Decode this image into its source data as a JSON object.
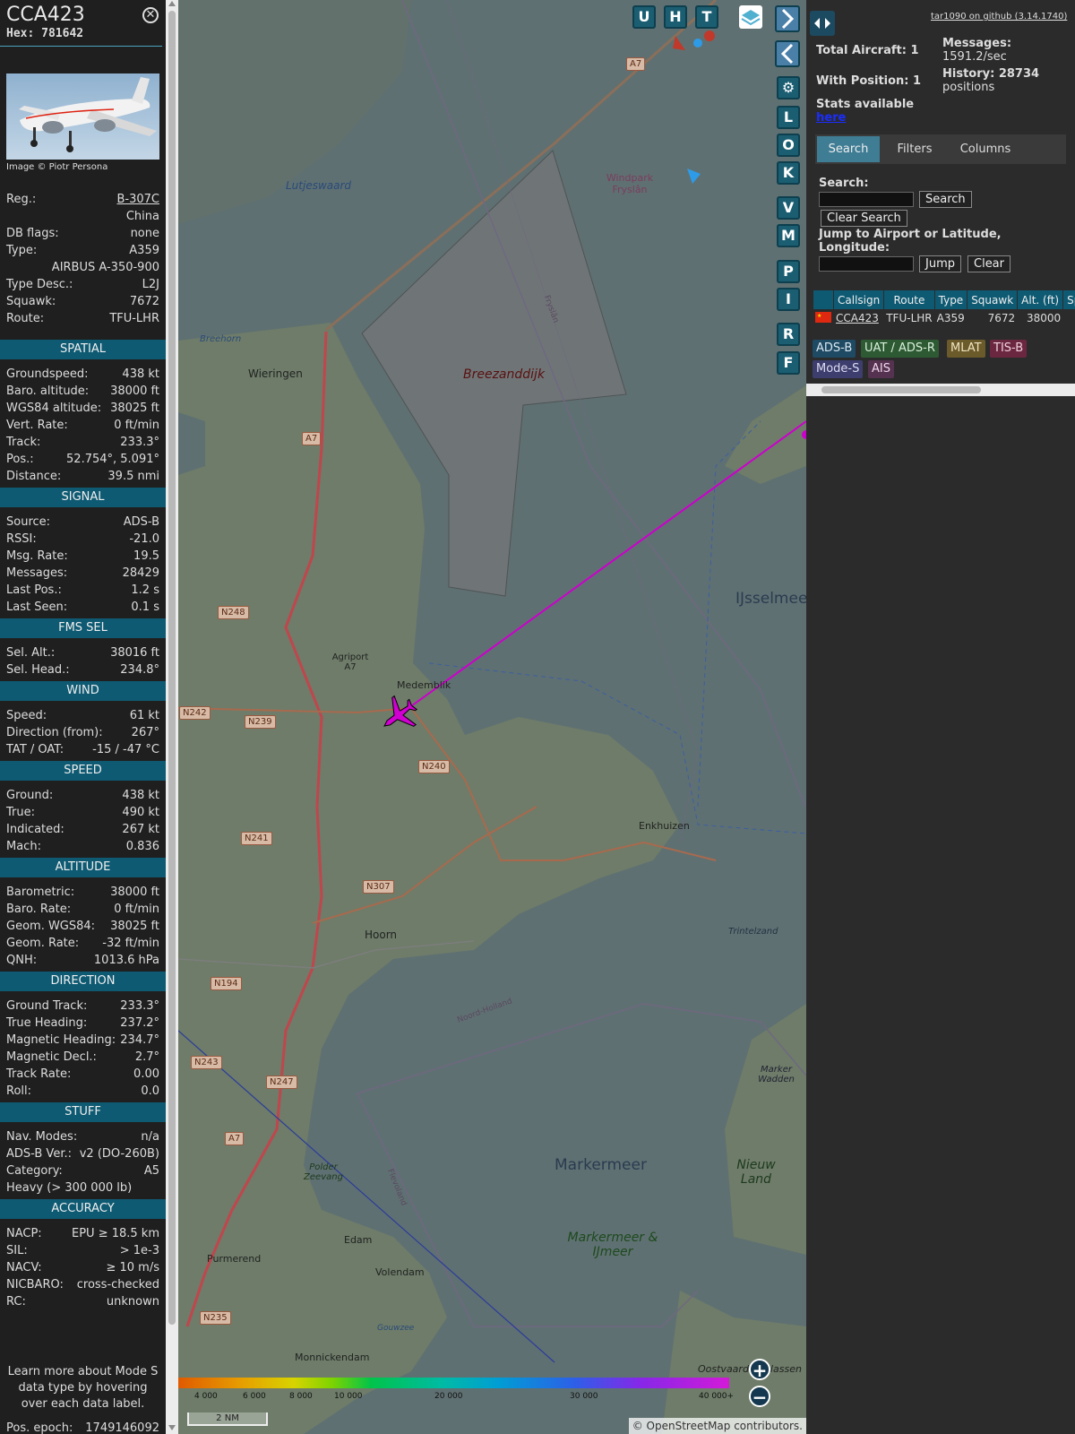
{
  "selected": {
    "callsign": "CCA423",
    "hex": "Hex: 781642",
    "close_icon": "close-icon",
    "photo_credit": "Image © Piotr Persona",
    "basic": [
      {
        "k": "Reg.:",
        "v": "B-307C",
        "link": true
      },
      {
        "k": "",
        "v": "China"
      },
      {
        "k": "DB flags:",
        "v": "none"
      },
      {
        "k": "Type:",
        "v": "A359"
      },
      {
        "k": "",
        "v": "AIRBUS A-350-900"
      },
      {
        "k": "Type Desc.:",
        "v": "L2J"
      },
      {
        "k": "Squawk:",
        "v": "7672"
      },
      {
        "k": "Route:",
        "v": "TFU-LHR"
      }
    ],
    "sections": [
      {
        "title": "SPATIAL",
        "rows": [
          {
            "k": "Groundspeed:",
            "v": "438 kt"
          },
          {
            "k": "Baro. altitude:",
            "v": "38000 ft"
          },
          {
            "k": "WGS84 altitude:",
            "v": "38025 ft"
          },
          {
            "k": "Vert. Rate:",
            "v": "0 ft/min"
          },
          {
            "k": "Track:",
            "v": "233.3°"
          },
          {
            "k": "Pos.:",
            "v": "52.754°, 5.091°"
          },
          {
            "k": "Distance:",
            "v": "39.5 nmi"
          }
        ]
      },
      {
        "title": "SIGNAL",
        "rows": [
          {
            "k": "Source:",
            "v": "ADS-B"
          },
          {
            "k": "RSSI:",
            "v": "-21.0"
          },
          {
            "k": "Msg. Rate:",
            "v": "19.5"
          },
          {
            "k": "Messages:",
            "v": "28429"
          },
          {
            "k": "Last Pos.:",
            "v": "1.2 s"
          },
          {
            "k": "Last Seen:",
            "v": "0.1 s"
          }
        ]
      },
      {
        "title": "FMS SEL",
        "rows": [
          {
            "k": "Sel. Alt.:",
            "v": "38016 ft"
          },
          {
            "k": "Sel. Head.:",
            "v": "234.8°"
          }
        ]
      },
      {
        "title": "WIND",
        "rows": [
          {
            "k": "Speed:",
            "v": "61 kt"
          },
          {
            "k": "Direction (from):",
            "v": "267°"
          },
          {
            "k": "TAT / OAT:",
            "v": "-15 / -47 °C"
          }
        ]
      },
      {
        "title": "SPEED",
        "rows": [
          {
            "k": "Ground:",
            "v": "438 kt"
          },
          {
            "k": "True:",
            "v": "490 kt"
          },
          {
            "k": "Indicated:",
            "v": "267 kt"
          },
          {
            "k": "Mach:",
            "v": "0.836"
          }
        ]
      },
      {
        "title": "ALTITUDE",
        "rows": [
          {
            "k": "Barometric:",
            "v": "38000 ft"
          },
          {
            "k": "Baro. Rate:",
            "v": "0 ft/min"
          },
          {
            "k": "Geom. WGS84:",
            "v": "38025 ft"
          },
          {
            "k": "Geom. Rate:",
            "v": "-32 ft/min"
          },
          {
            "k": "QNH:",
            "v": "1013.6 hPa"
          }
        ]
      },
      {
        "title": "DIRECTION",
        "rows": [
          {
            "k": "Ground Track:",
            "v": "233.3°"
          },
          {
            "k": "True Heading:",
            "v": "237.2°"
          },
          {
            "k": "Magnetic Heading:",
            "v": "234.7°"
          },
          {
            "k": "Magnetic Decl.:",
            "v": "2.7°"
          },
          {
            "k": "Track Rate:",
            "v": "0.00"
          },
          {
            "k": "Roll:",
            "v": "0.0"
          }
        ]
      },
      {
        "title": "STUFF",
        "rows": [
          {
            "k": "Nav. Modes:",
            "v": "n/a"
          },
          {
            "k": "ADS-B Ver.:",
            "v": "v2 (DO-260B)"
          },
          {
            "k": "Category:",
            "v": "A5"
          },
          {
            "k": "Heavy (> 300 000 lb)",
            "v": ""
          }
        ]
      },
      {
        "title": "ACCURACY",
        "rows": [
          {
            "k": "NACP:",
            "v": "EPU ≥ 18.5 km"
          },
          {
            "k": "SIL:",
            "v": "> 1e-3"
          },
          {
            "k": "NACV:",
            "v": "≥ 10 m/s"
          },
          {
            "k": "NICBARO:",
            "v": "cross-checked"
          },
          {
            "k": "RC:",
            "v": "unknown"
          }
        ]
      }
    ],
    "learn_more": "Learn more about Mode S data type by hovering over each data label.",
    "pos_epoch_label": "Pos. epoch:",
    "pos_epoch_value": "1749146092"
  },
  "map": {
    "buttons_top": [
      "U",
      "H",
      "T"
    ],
    "buttons_side": [
      "L",
      "O",
      "K",
      "V",
      "M",
      "P",
      "I",
      "R",
      "F"
    ],
    "labels": {
      "lutjeswaard": "Lutjeswaard",
      "windpark": "Windpark Fryslân",
      "breezanddijk": "Breezanddijk",
      "wieringen": "Wieringen",
      "breehorn": "Breehorn",
      "ijsselmeer": "IJsselmeer",
      "medemblik": "Medemblik",
      "agriport": "Agriport A7",
      "enkhuizen": "Enkhuizen",
      "hoorn": "Hoorn",
      "trintelzand": "Trintelzand",
      "markermeer": "Markermeer",
      "markermeer_ijmeer": "Markermeer & IJmeer",
      "nieuw_land": "Nieuw Land",
      "marker_wadden": "Marker Wadden",
      "polder_zeevang": "Polder Zeevang",
      "edam": "Edam",
      "volendam": "Volendam",
      "purmerend": "Purmerend",
      "monnickendam": "Monnickendam",
      "oostvaardersplassen": "Oostvaardersplassen",
      "gouwzee": "Gouwzee",
      "noord_holland": "Noord-Holland",
      "fryslan": "Fryslân",
      "flevoland": "Flevoland"
    },
    "roads": [
      "A7",
      "N248",
      "N242",
      "N239",
      "N240",
      "N241",
      "N307",
      "N194",
      "N243",
      "N247",
      "N235"
    ],
    "colorbar_ticks": [
      "4 000",
      "6 000",
      "8 000",
      "10 000",
      "20 000",
      "30 000",
      "40 000+"
    ],
    "scale": "2 NM",
    "attribution": "© OpenStreetMap contributors."
  },
  "right": {
    "github": "tar1090 on github (3.14.1740)",
    "total_aircraft": "Total Aircraft: 1",
    "with_position": "With Position: 1",
    "messages_label": "Messages:",
    "messages_value": "1591.2/sec",
    "history_label": "History: 28734",
    "history_value": "positions",
    "stats_available": "Stats available",
    "stats_link": "here",
    "tabs": [
      "Search",
      "Filters",
      "Columns"
    ],
    "search_label": "Search:",
    "search_button": "Search",
    "clear_search_button": "Clear Search",
    "jump_label": "Jump to Airport or Latitude, Longitude:",
    "jump_button": "Jump",
    "clear_button": "Clear",
    "table": {
      "headers": [
        "",
        "Callsign",
        "Route",
        "Type",
        "Squawk",
        "Alt. (ft)",
        "Sp"
      ],
      "rows": [
        {
          "flag": "china-flag-icon",
          "callsign": "CCA423",
          "route": "TFU-LHR",
          "type": "A359",
          "squawk": "7672",
          "alt": "38000"
        }
      ]
    },
    "badges": [
      "ADS-B",
      "UAT / ADS-R",
      "MLAT",
      "TIS-B",
      "Mode-S",
      "AIS"
    ]
  },
  "colors": {
    "accent": "#0e5a73",
    "track": "#cc00cc"
  }
}
